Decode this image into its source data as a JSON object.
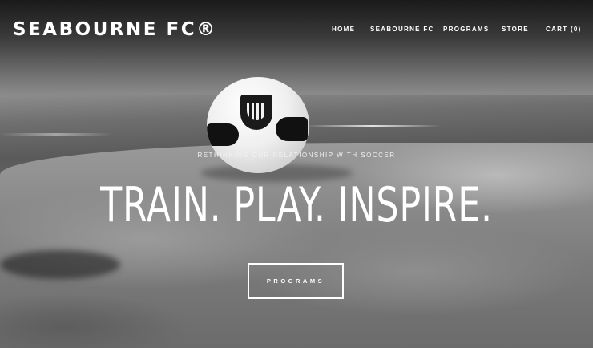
{
  "brand": {
    "logo_text": "SEABOURNE FC®"
  },
  "nav": {
    "items": [
      {
        "label": "HOME"
      },
      {
        "label": "SEABOURNE FC"
      },
      {
        "label": "PROGRAMS"
      },
      {
        "label": "STORE"
      },
      {
        "label": "CART (0)"
      }
    ]
  },
  "hero": {
    "tagline": "RETHINKING OUR RELATIONSHIP WITH SOCCER",
    "headline": "TRAIN. PLAY. INSPIRE.",
    "cta_label": "PROGRAMS"
  }
}
